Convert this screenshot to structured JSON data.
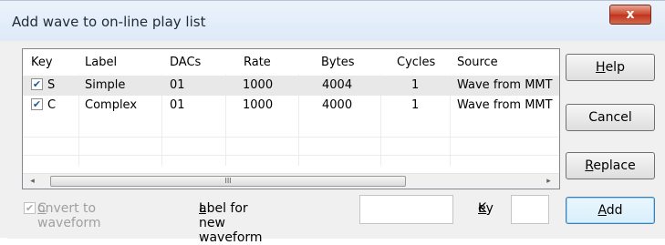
{
  "window": {
    "title": "Add wave to on-line play list",
    "close_label": "x"
  },
  "list": {
    "columns": [
      "Key",
      "Label",
      "DACs",
      "Rate",
      "Bytes",
      "Cycles",
      "Source"
    ],
    "rows": [
      {
        "checked": true,
        "key": "S",
        "label": "Simple",
        "dacs": "01",
        "rate": "1000",
        "bytes": "4004",
        "cycles": "1",
        "source": "Wave from MMT"
      },
      {
        "checked": true,
        "key": "C",
        "label": "Complex",
        "dacs": "01",
        "rate": "1000",
        "bytes": "4000",
        "cycles": "1",
        "source": "Wave from MMT"
      }
    ],
    "scroll": {
      "left_arrow": "◂",
      "right_arrow": "▸",
      "thumb_grip": "III"
    }
  },
  "buttons": {
    "help": {
      "pre": "",
      "accel": "H",
      "post": "elp"
    },
    "cancel": "Cancel",
    "replace": {
      "pre": "",
      "accel": "R",
      "post": "eplace"
    },
    "add": {
      "pre": "",
      "accel": "A",
      "post": "dd"
    }
  },
  "bottom": {
    "convert": {
      "checked": true,
      "pre": "",
      "accel": "C",
      "post": "onvert to waveform"
    },
    "label_new": {
      "pre": "",
      "accel": "L",
      "post": "abel for new waveform"
    },
    "label_value": "",
    "key": {
      "pre": "",
      "accel": "K",
      "post": "ey"
    },
    "key_value": ""
  },
  "colors": {
    "close": "#c9452b",
    "check": "#1f5b96",
    "default_border": "#3c7fb1"
  }
}
